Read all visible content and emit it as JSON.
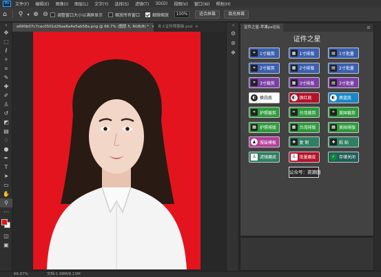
{
  "menu": {
    "logo": "Ps",
    "items": [
      "文件(F)",
      "编辑(E)",
      "图像(I)",
      "图层(L)",
      "文字(Y)",
      "选择(S)",
      "滤镜(T)",
      "3D(D)",
      "视图(V)",
      "窗口(W)",
      "帮助(H)"
    ]
  },
  "options": {
    "resize_windows_label": "调整窗口大小以满屏显示",
    "zoom_all_label": "缩放所有窗口",
    "scrubby_zoom_label": "细微缩放",
    "zoom_value": "100%",
    "fit_screen_label": "适合屏幕",
    "fill_screen_label": "填充屏幕"
  },
  "tabs": [
    {
      "label": "a690b07c7cac0501d26aa6a4e5ab58a.png @ 66.7% (图层 5, RGB/8) *",
      "close": "×"
    },
    {
      "label": "女士证件照服装.psd",
      "close": "×"
    }
  ],
  "status": {
    "zoom": "66.67%",
    "doc": "文档:1.98M/6.13M"
  },
  "panel": {
    "tab": "证件之星-苹果ps论坛",
    "menu_icon": "≡",
    "title": "证件之星",
    "rows": [
      [
        {
          "label": "1寸裁剪",
          "color": "blue",
          "icon": "crop-icon"
        },
        {
          "label": "1寸排版",
          "color": "blue",
          "icon": "layout-icon"
        },
        {
          "label": "1寸批量",
          "color": "blue",
          "icon": "batch-icon"
        }
      ],
      [
        {
          "label": "2寸裁剪",
          "color": "blue",
          "icon": "crop-icon"
        },
        {
          "label": "2寸排版",
          "color": "blue",
          "icon": "layout-icon"
        },
        {
          "label": "2寸批量",
          "color": "blue",
          "icon": "batch-icon"
        }
      ],
      [
        {
          "label": "3寸裁剪",
          "color": "purple",
          "icon": "crop-icon"
        },
        {
          "label": "3寸排版",
          "color": "purple",
          "icon": "layout-icon"
        },
        {
          "label": "3寸批量",
          "color": "purple",
          "icon": "batch-icon"
        }
      ],
      [
        {
          "label": "换白底",
          "color": "white",
          "icon": "background-icon"
        },
        {
          "label": "换红底",
          "color": "red",
          "icon": "background-icon"
        },
        {
          "label": "换蓝底",
          "color": "cyan",
          "icon": "background-icon"
        }
      ],
      [
        {
          "label": "护照裁剪",
          "color": "green",
          "icon": "crop-icon"
        },
        {
          "label": "台湾裁剪",
          "color": "green",
          "icon": "crop-icon"
        },
        {
          "label": "美国裁剪",
          "color": "green",
          "icon": "crop-icon"
        }
      ],
      [
        {
          "label": "护照排版",
          "color": "green",
          "icon": "layout-icon"
        },
        {
          "label": "台湾排版",
          "color": "green",
          "icon": "layout-icon"
        },
        {
          "label": "美国排版",
          "color": "green",
          "icon": "layout-icon"
        }
      ],
      [
        {
          "label": "服装模板",
          "color": "pink",
          "icon": "clothes-icon"
        },
        {
          "label": "复 制",
          "color": "teal",
          "icon": "copy-icon"
        },
        {
          "label": "粘 贴",
          "color": "teal",
          "icon": "paste-icon"
        }
      ],
      [
        {
          "label": "滤镜磨皮",
          "color": "teal",
          "icon": "person-icon"
        },
        {
          "label": "批量磨皮",
          "color": "red",
          "icon": "person-icon"
        },
        {
          "label": "存储关闭",
          "color": "teal-dark",
          "icon": "save-close-icon"
        }
      ]
    ],
    "footer": "公众号：资源园"
  },
  "colors": {
    "photo_background": "#e3141e",
    "foreground_swatch": "#e11111",
    "background_swatch": "#ffffff"
  }
}
